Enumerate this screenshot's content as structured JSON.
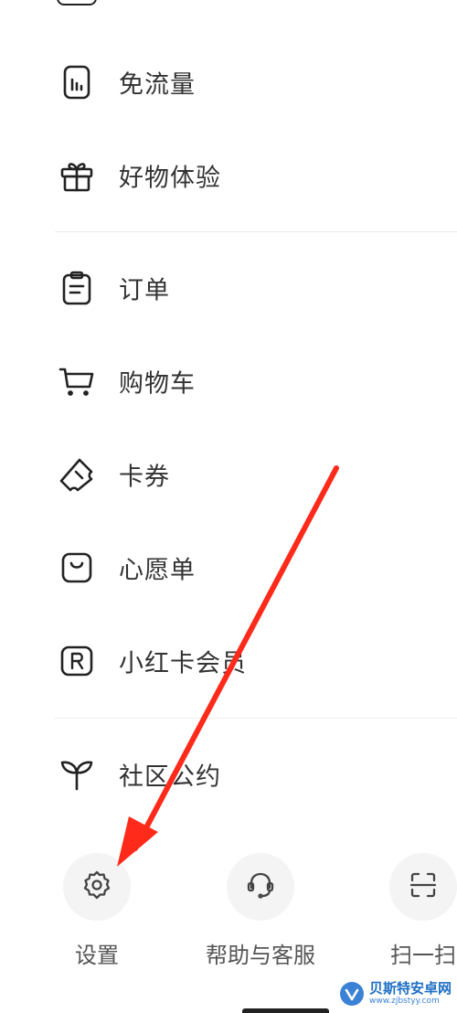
{
  "menu": {
    "section1": [
      {
        "label": "免流量",
        "icon": "data-card-icon"
      },
      {
        "label": "好物体验",
        "icon": "gift-icon"
      }
    ],
    "section2": [
      {
        "label": "订单",
        "icon": "clipboard-icon"
      },
      {
        "label": "购物车",
        "icon": "cart-icon"
      },
      {
        "label": "卡券",
        "icon": "coupon-icon"
      },
      {
        "label": "心愿单",
        "icon": "wishlist-bag-icon"
      },
      {
        "label": "小红卡会员",
        "icon": "membership-card-icon"
      }
    ],
    "section3": [
      {
        "label": "社区公约",
        "icon": "sprout-icon"
      }
    ]
  },
  "bottom_actions": [
    {
      "label": "设置",
      "icon": "gear-icon"
    },
    {
      "label": "帮助与客服",
      "icon": "headset-icon"
    },
    {
      "label": "扫一扫",
      "icon": "scan-icon"
    }
  ],
  "annotation": {
    "color": "#ff2a1a"
  },
  "watermark": {
    "name": "贝斯特安卓网",
    "url": "www.zjbstyy.com",
    "color": "#3b82d6"
  }
}
